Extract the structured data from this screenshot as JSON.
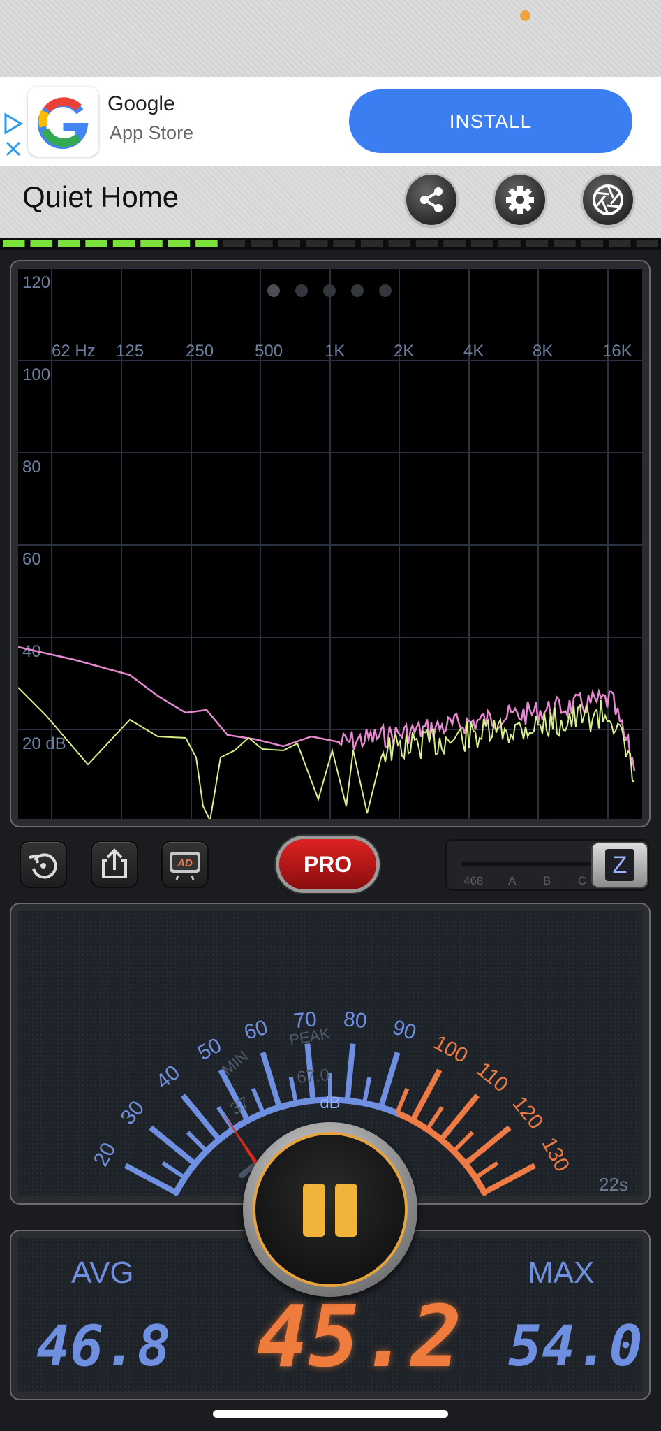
{
  "ad": {
    "title": "Google",
    "subtitle": "App Store",
    "install_label": "INSTALL",
    "logo_letter": "G"
  },
  "header": {
    "title": "Quiet Home",
    "share_icon": "share-icon",
    "settings_icon": "gear-icon",
    "camera_icon": "aperture-icon"
  },
  "level_meter": {
    "lit_segments": 8,
    "total_segments": 24,
    "color": "#7be13b"
  },
  "spectrum": {
    "page_dots": 5,
    "active_dot": 0,
    "freq_labels": [
      "62 Hz",
      "125",
      "250",
      "500",
      "1K",
      "2K",
      "4K",
      "8K",
      "16K"
    ],
    "db_labels": [
      "120",
      "100",
      "80",
      "60",
      "40",
      "20 dB"
    ]
  },
  "controls": {
    "pro_label": "PRO",
    "ad_label": "AD",
    "weighting_labels": [
      "468",
      "A",
      "B",
      "C"
    ],
    "weighting_selected": "Z"
  },
  "meter": {
    "scale_labels": [
      "20",
      "30",
      "40",
      "50",
      "60",
      "70",
      "80",
      "90",
      "100",
      "110",
      "120",
      "130"
    ],
    "min_label": "MIN",
    "min_value": "37",
    "peak_label": "PEAK",
    "peak_value": "67.0",
    "unit": "dB",
    "timer": "22s",
    "needle_value": 45.2,
    "blue": "#6f8fe0",
    "orange": "#ee7a45"
  },
  "readout": {
    "avg_label": "AVG",
    "avg_value": "46.8",
    "current_value": "45.2",
    "max_label": "MAX",
    "max_value": "54.0"
  }
}
